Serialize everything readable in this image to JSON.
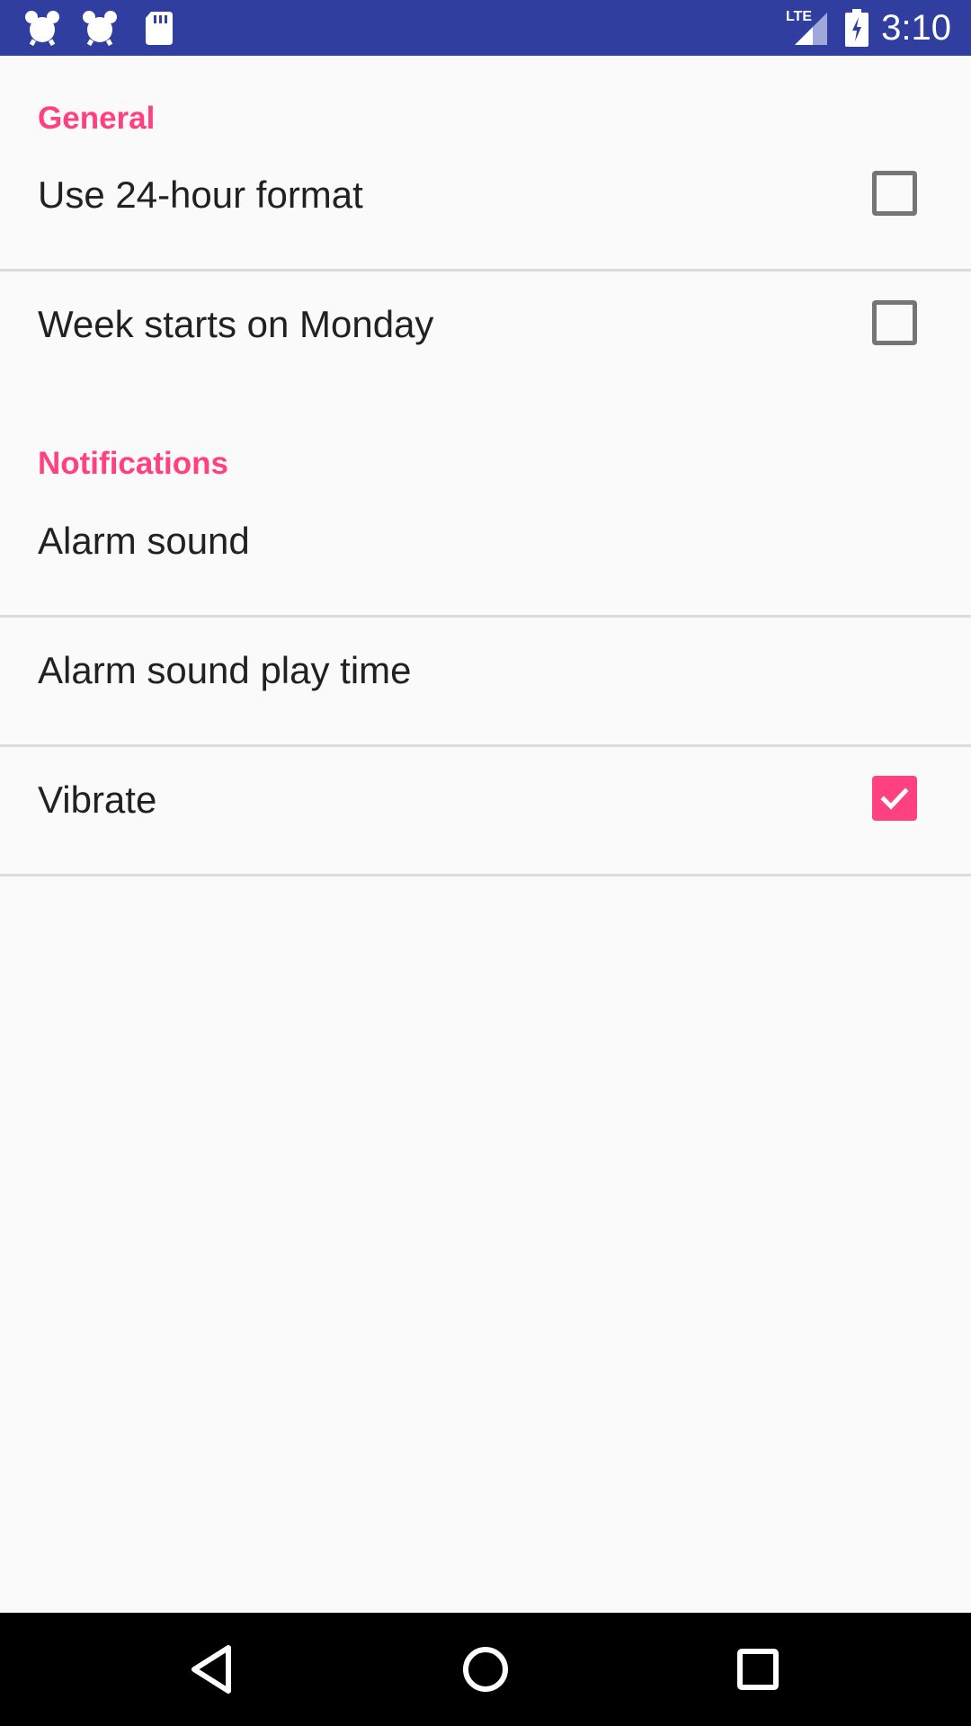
{
  "status_bar": {
    "time": "3:10",
    "network": "LTE",
    "left_icons": [
      "alarm-icon",
      "alarm-icon",
      "sd-card-icon"
    ],
    "right_icons": [
      "signal-icon",
      "battery-charging-icon"
    ],
    "background": "#303f9f"
  },
  "settings": {
    "sections": [
      {
        "header": "General",
        "items": [
          {
            "title": "Use 24-hour format",
            "checkbox": true,
            "checked": false
          },
          {
            "title": "Week starts on Monday",
            "checkbox": true,
            "checked": false
          }
        ]
      },
      {
        "header": "Notifications",
        "items": [
          {
            "title": "Alarm sound",
            "checkbox": false
          },
          {
            "title": "Alarm sound play time",
            "checkbox": false
          },
          {
            "title": "Vibrate",
            "checkbox": true,
            "checked": true
          }
        ]
      }
    ],
    "accent_color": "#ff4081"
  },
  "nav_bar": {
    "buttons": [
      "back-icon",
      "home-icon",
      "recents-icon"
    ]
  }
}
